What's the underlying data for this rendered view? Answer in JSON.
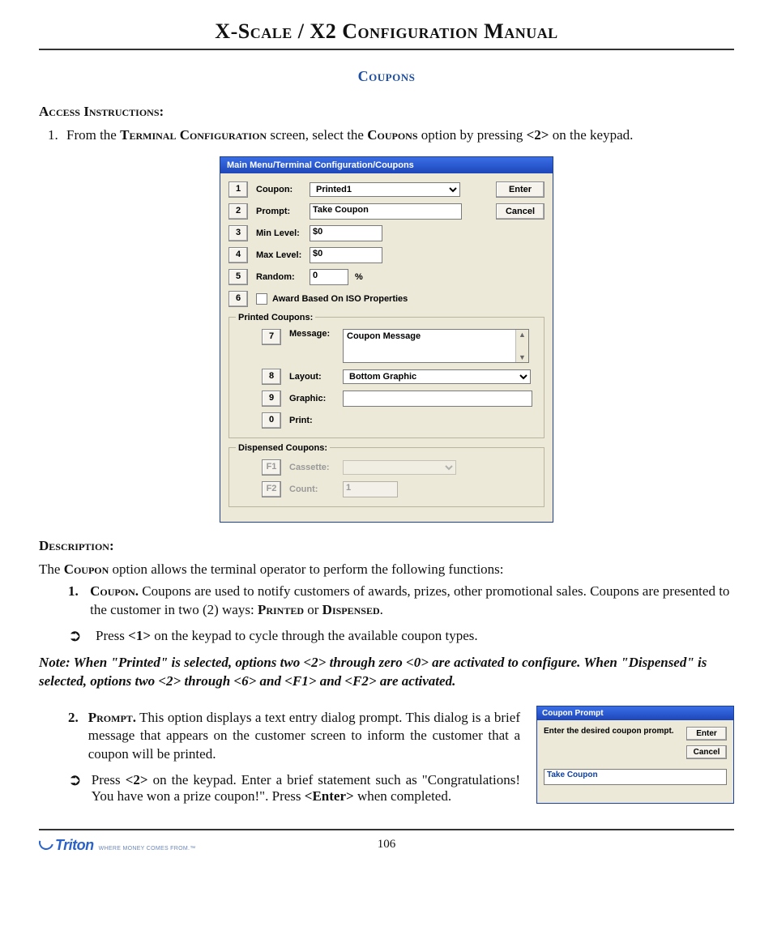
{
  "header": {
    "title": "X-Scale / X2 Configuration Manual"
  },
  "section": {
    "title": "Coupons"
  },
  "access": {
    "heading": "Access Instructions:",
    "item1_pre": "From the ",
    "item1_sc1": "Terminal Configuration",
    "item1_mid": " screen, select the ",
    "item1_sc2": "Coupons",
    "item1_post": " option by pressing ",
    "item1_key": "<2>",
    "item1_end": " on the keypad."
  },
  "dialog": {
    "title": "Main Menu/Terminal Configuration/Coupons",
    "buttons": {
      "enter": "Enter",
      "cancel": "Cancel"
    },
    "rows": {
      "r1": {
        "key": "1",
        "label": "Coupon:",
        "value": "Printed1"
      },
      "r2": {
        "key": "2",
        "label": "Prompt:",
        "value": "Take Coupon"
      },
      "r3": {
        "key": "3",
        "label": "Min Level:",
        "value": "$0"
      },
      "r4": {
        "key": "4",
        "label": "Max Level:",
        "value": "$0"
      },
      "r5": {
        "key": "5",
        "label": "Random:",
        "value": "0",
        "unit": "%"
      },
      "r6": {
        "key": "6",
        "label": "Award Based On ISO Properties"
      }
    },
    "printed": {
      "legend": "Printed Coupons:",
      "r7": {
        "key": "7",
        "label": "Message:",
        "value": "Coupon Message"
      },
      "r8": {
        "key": "8",
        "label": "Layout:",
        "value": "Bottom Graphic"
      },
      "r9": {
        "key": "9",
        "label": "Graphic:"
      },
      "r0": {
        "key": "0",
        "label": "Print:"
      }
    },
    "dispensed": {
      "legend": "Dispensed Coupons:",
      "f1": {
        "key": "F1",
        "label": "Cassette:"
      },
      "f2": {
        "key": "F2",
        "label": "Count:",
        "value": "1"
      }
    }
  },
  "desc": {
    "heading": "Description:",
    "intro_pre": "The ",
    "intro_sc": "Coupon",
    "intro_post": " option allows the terminal operator to perform the following functions:",
    "i1": {
      "num": "1.",
      "sc": "Coupon.",
      "text": "  Coupons are used to notify customers of awards, prizes, other promotional sales.  Coupons are presented to the customer in two (2) ways:  ",
      "sc2": "Printed",
      "or": " or ",
      "sc3": "Dispensed",
      "dot": "."
    },
    "a1": {
      "text_pre": "Press ",
      "key": "<1>",
      "text_post": " on the keypad to cycle through the available coupon types."
    },
    "note": "Note:  When \"Printed\" is selected, options two <2> through zero <0> are activated to configure.  When \"Dispensed\" is selected, options two <2> through <6> and <F1> and <F2> are activated.",
    "i2": {
      "num": "2.",
      "sc": "Prompt.",
      "text": "  This option displays a text entry dialog prompt.  This dialog is a brief message that appears on the customer screen to inform the customer that a coupon will be printed."
    },
    "a2": {
      "text_pre": "Press ",
      "key": "<2>",
      "text_mid": " on the keypad.  Enter a brief statement such as \"Congratulations!  You have won a prize coupon!\".  Press ",
      "key2": "<Enter>",
      "text_post": " when completed."
    }
  },
  "prompt_dialog": {
    "title": "Coupon Prompt",
    "msg": "Enter the desired coupon prompt.",
    "enter": "Enter",
    "cancel": "Cancel",
    "value": "Take Coupon"
  },
  "footer": {
    "page": "106",
    "logo": "Triton",
    "tag": "WHERE MONEY COMES FROM.™"
  }
}
